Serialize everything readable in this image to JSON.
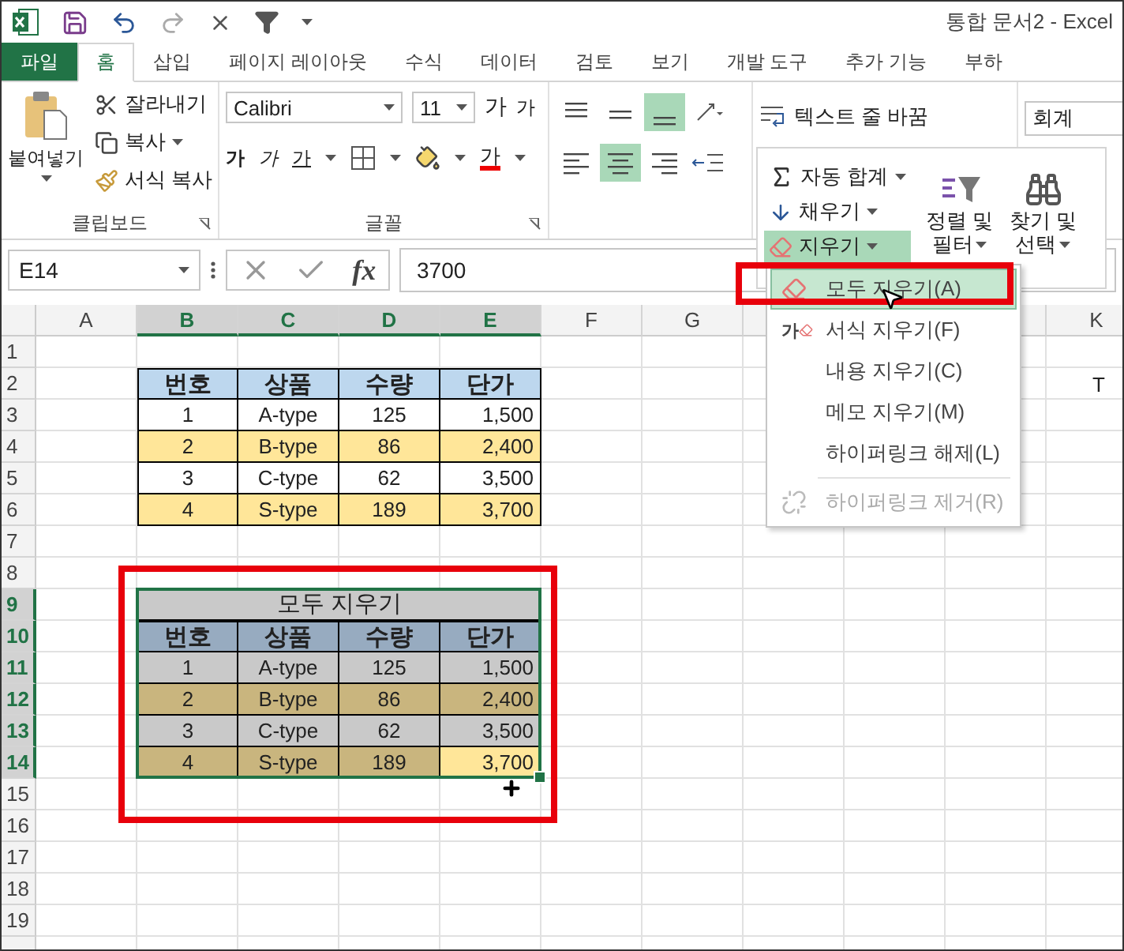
{
  "window": {
    "title": "통합 문서2 - Excel"
  },
  "tabs": [
    {
      "label": "파일",
      "kind": "file",
      "selected": false
    },
    {
      "label": "홈",
      "kind": "tab",
      "selected": true
    },
    {
      "label": "삽입",
      "kind": "tab",
      "selected": false
    },
    {
      "label": "페이지 레이아웃",
      "kind": "tab",
      "selected": false
    },
    {
      "label": "수식",
      "kind": "tab",
      "selected": false
    },
    {
      "label": "데이터",
      "kind": "tab",
      "selected": false
    },
    {
      "label": "검토",
      "kind": "tab",
      "selected": false
    },
    {
      "label": "보기",
      "kind": "tab",
      "selected": false
    },
    {
      "label": "개발 도구",
      "kind": "tab",
      "selected": false
    },
    {
      "label": "추가 기능",
      "kind": "tab",
      "selected": false
    },
    {
      "label": "부하",
      "kind": "tab",
      "selected": false
    }
  ],
  "ribbon": {
    "clipboard": {
      "paste": "붙여넣기",
      "cut": "잘라내기",
      "copy": "복사",
      "format_painter": "서식 복사",
      "label": "클립보드"
    },
    "font": {
      "name": "Calibri",
      "size": "11",
      "grow": "가",
      "shrink": "가",
      "bold": "가",
      "italic": "가",
      "underline": "가",
      "font_color": "가",
      "label": "글꼴"
    },
    "alignment": {
      "wrap_text": "텍스트 줄 바꿈"
    },
    "number": {
      "format": "회계"
    },
    "editing": {
      "autosum": "자동 합계",
      "fill": "채우기",
      "clear": {
        "label": "지우기",
        "selected": true
      },
      "sort": [
        "정렬 및",
        "필터"
      ],
      "find": [
        "찾기 및",
        "선택"
      ]
    }
  },
  "clear_menu": [
    {
      "label": "모두 지우기(A)",
      "kind": "eraser",
      "selected": true,
      "disabled": false,
      "separator_before": false
    },
    {
      "label": "서식 지우기(F)",
      "kind": "format-eraser",
      "glyph": "가",
      "selected": false,
      "disabled": false,
      "separator_before": false
    },
    {
      "label": "내용 지우기(C)",
      "kind": "plain",
      "selected": false,
      "disabled": false,
      "separator_before": false
    },
    {
      "label": "메모 지우기(M)",
      "kind": "plain",
      "selected": false,
      "disabled": false,
      "separator_before": false
    },
    {
      "label": "하이퍼링크 해제(L)",
      "kind": "plain",
      "selected": false,
      "disabled": false,
      "separator_before": false
    },
    {
      "label": "하이퍼링크 제거(R)",
      "kind": "unlink",
      "selected": false,
      "disabled": true,
      "separator_before": true
    }
  ],
  "formula_bar": {
    "name_box": "E14",
    "fx_label": "fx",
    "value": "3700"
  },
  "columns": [
    {
      "label": "A",
      "selected": false
    },
    {
      "label": "B",
      "selected": true
    },
    {
      "label": "C",
      "selected": true
    },
    {
      "label": "D",
      "selected": true
    },
    {
      "label": "E",
      "selected": true
    },
    {
      "label": "F",
      "selected": false
    },
    {
      "label": "G",
      "selected": false
    }
  ],
  "far_column": "K",
  "far_cell": "T",
  "rows": [
    {
      "label": "1",
      "selected": false
    },
    {
      "label": "2",
      "selected": false
    },
    {
      "label": "3",
      "selected": false
    },
    {
      "label": "4",
      "selected": false
    },
    {
      "label": "5",
      "selected": false
    },
    {
      "label": "6",
      "selected": false
    },
    {
      "label": "7",
      "selected": false
    },
    {
      "label": "8",
      "selected": false
    },
    {
      "label": "9",
      "selected": true
    },
    {
      "label": "10",
      "selected": true
    },
    {
      "label": "11",
      "selected": true
    },
    {
      "label": "12",
      "selected": true
    },
    {
      "label": "13",
      "selected": true
    },
    {
      "label": "14",
      "selected": true
    },
    {
      "label": "15",
      "selected": false
    },
    {
      "label": "16",
      "selected": false
    },
    {
      "label": "17",
      "selected": false
    },
    {
      "label": "18",
      "selected": false
    },
    {
      "label": "19",
      "selected": false
    }
  ],
  "table_1": {
    "header": [
      "번호",
      "상품",
      "수량",
      "단가"
    ],
    "rows": [
      {
        "cells": [
          "1",
          "A-type",
          "125",
          "1,500"
        ],
        "highlight": false
      },
      {
        "cells": [
          "2",
          "B-type",
          "86",
          "2,400"
        ],
        "highlight": true
      },
      {
        "cells": [
          "3",
          "C-type",
          "62",
          "3,500"
        ],
        "highlight": false
      },
      {
        "cells": [
          "4",
          "S-type",
          "189",
          "3,700"
        ],
        "highlight": true
      }
    ]
  },
  "table_2": {
    "title": "모두 지우기",
    "header": [
      "번호",
      "상품",
      "수량",
      "단가"
    ],
    "rows": [
      {
        "cells": [
          {
            "text": "1",
            "active": false
          },
          {
            "text": "A-type",
            "active": false
          },
          {
            "text": "125",
            "active": false
          },
          {
            "text": "1,500",
            "active": false
          }
        ],
        "highlight": false
      },
      {
        "cells": [
          {
            "text": "2",
            "active": false
          },
          {
            "text": "B-type",
            "active": false
          },
          {
            "text": "86",
            "active": false
          },
          {
            "text": "2,400",
            "active": false
          }
        ],
        "highlight": true
      },
      {
        "cells": [
          {
            "text": "3",
            "active": false
          },
          {
            "text": "C-type",
            "active": false
          },
          {
            "text": "62",
            "active": false
          },
          {
            "text": "3,500",
            "active": false
          }
        ],
        "highlight": false
      },
      {
        "cells": [
          {
            "text": "4",
            "active": false
          },
          {
            "text": "S-type",
            "active": false
          },
          {
            "text": "189",
            "active": false
          },
          {
            "text": "3,700",
            "active": true
          }
        ],
        "highlight": true
      }
    ]
  }
}
